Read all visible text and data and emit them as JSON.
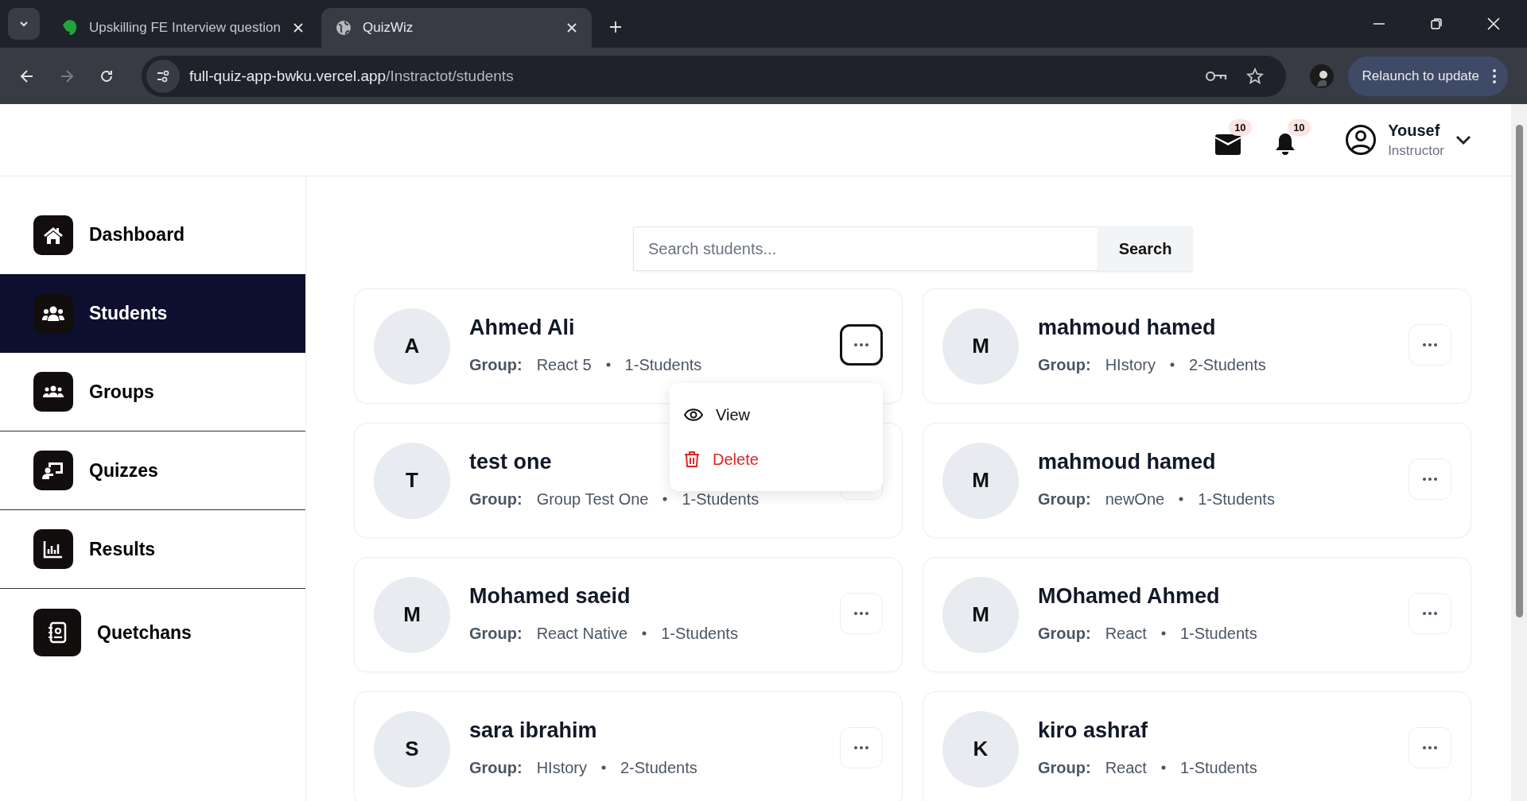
{
  "browser": {
    "tabs": [
      {
        "title": "Upskilling FE Interview question",
        "selected": false
      },
      {
        "title": "QuizWiz",
        "selected": true
      }
    ],
    "url_host": "full-quiz-app-bwku.vercel.app",
    "url_path": "/Instractot/students",
    "relaunch": "Relaunch to update"
  },
  "header": {
    "mail_count": "10",
    "notification_count": "10",
    "user_name": "Yousef",
    "user_role": "Instructor"
  },
  "sidebar": {
    "items": [
      {
        "label": "Dashboard",
        "selected": false
      },
      {
        "label": "Students",
        "selected": true
      },
      {
        "label": "Groups",
        "selected": false
      },
      {
        "label": "Quizzes",
        "selected": false
      },
      {
        "label": "Results",
        "selected": false
      },
      {
        "label": "Quetchans",
        "selected": false
      }
    ]
  },
  "search": {
    "placeholder": "Search students...",
    "button": "Search"
  },
  "students": [
    {
      "initial": "A",
      "name": "Ahmed Ali",
      "group_label": "Group:",
      "group": "React 5",
      "count": "1-Students",
      "menu_open": true
    },
    {
      "initial": "M",
      "name": "mahmoud hamed",
      "group_label": "Group:",
      "group": "HIstory",
      "count": "2-Students",
      "menu_open": false
    },
    {
      "initial": "T",
      "name": "test one",
      "group_label": "Group:",
      "group": "Group Test One",
      "count": "1-Students",
      "menu_open": false
    },
    {
      "initial": "M",
      "name": "mahmoud hamed",
      "group_label": "Group:",
      "group": "newOne",
      "count": "1-Students",
      "menu_open": false
    },
    {
      "initial": "M",
      "name": "Mohamed saeid",
      "group_label": "Group:",
      "group": "React Native",
      "count": "1-Students",
      "menu_open": false
    },
    {
      "initial": "M",
      "name": "MOhamed Ahmed",
      "group_label": "Group:",
      "group": "React",
      "count": "1-Students",
      "menu_open": false
    },
    {
      "initial": "S",
      "name": "sara ibrahim",
      "group_label": "Group:",
      "group": "HIstory",
      "count": "2-Students",
      "menu_open": false
    },
    {
      "initial": "K",
      "name": "kiro ashraf",
      "group_label": "Group:",
      "group": "React",
      "count": "1-Students",
      "menu_open": false
    }
  ],
  "menu": [
    {
      "label": "View",
      "kind": "view"
    },
    {
      "label": "Delete",
      "kind": "delete"
    }
  ]
}
